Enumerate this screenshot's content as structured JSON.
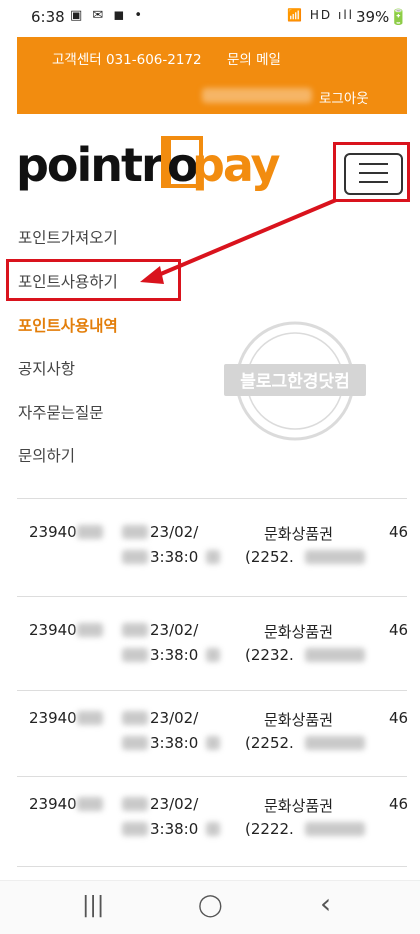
{
  "status_bar": {
    "time": "6:38",
    "left_icons": "▣ ✉ ◼ •",
    "right_icons": "📶 HD ıll",
    "battery": "39%🔋"
  },
  "top_bar": {
    "customer_center": "고객센터 031-606-2172",
    "inquiry_mail": "문의 메일",
    "logout": "로그아웃"
  },
  "logo": {
    "part1": "pointr",
    "part2": "o",
    "part3": "pay"
  },
  "menu": {
    "items": [
      {
        "label": "포인트가져오기"
      },
      {
        "label": "포인트사용하기"
      },
      {
        "label": "포인트사용내역"
      },
      {
        "label": "공지사항"
      },
      {
        "label": "자주묻는질문"
      },
      {
        "label": "문의하기"
      }
    ]
  },
  "watermark": {
    "text": "블로그한경닷컴"
  },
  "rows": [
    {
      "id": "23940",
      "date": "23/02/",
      "time": "3:38:0",
      "product": "문화상품권",
      "code": "(2252.",
      "amount": "46"
    },
    {
      "id": "23940",
      "date": "23/02/",
      "time": "3:38:0",
      "product": "문화상품권",
      "code": "(2232.",
      "amount": "46"
    },
    {
      "id": "23940",
      "date": "23/02/",
      "time": "3:38:0",
      "product": "문화상품권",
      "code": "(2252.",
      "amount": "46"
    },
    {
      "id": "23940",
      "date": "23/02/",
      "time": "3:38:0",
      "product": "문화상품권",
      "code": "(2222.",
      "amount": "46"
    }
  ],
  "nav_bar": {
    "recents": "|||",
    "home": "◯",
    "back": "‹"
  },
  "colors": {
    "accent": "#f28c0f",
    "annotation": "#d9131d"
  }
}
